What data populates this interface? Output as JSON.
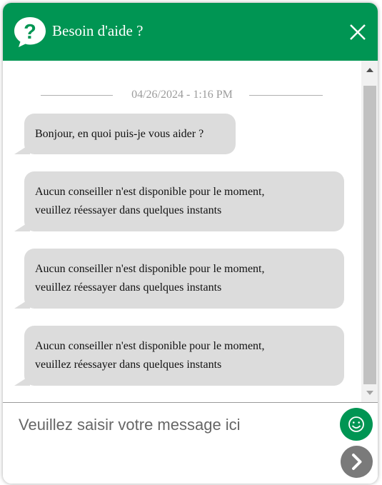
{
  "header": {
    "title": "Besoin d'aide ?",
    "icon": "question-bubble-icon",
    "close_icon": "close-icon"
  },
  "conversation": {
    "date_separator": "04/26/2024 - 1:16 PM",
    "messages": [
      {
        "lines": [
          "Bonjour, en quoi puis-je vous aider ?"
        ]
      },
      {
        "lines": [
          "Aucun conseiller n'est disponible pour le moment,",
          "veuillez réessayer dans quelques instants"
        ]
      },
      {
        "lines": [
          "Aucun conseiller n'est disponible pour le moment,",
          "veuillez réessayer dans quelques instants"
        ]
      },
      {
        "lines": [
          "Aucun conseiller n'est disponible pour le moment,",
          "veuillez réessayer dans quelques instants"
        ]
      }
    ]
  },
  "composer": {
    "placeholder": "Veuillez saisir votre message ici",
    "emoji_icon": "emoji-smile-icon",
    "send_icon": "chevron-right-icon"
  },
  "colors": {
    "brand": "#009553",
    "bubble": "#dcdcdc",
    "send_button": "#7a7a7a"
  }
}
